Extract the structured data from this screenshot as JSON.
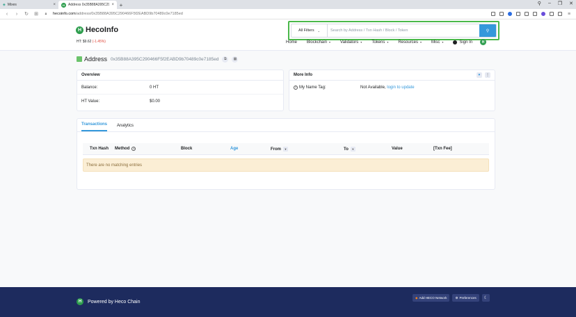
{
  "browser": {
    "tabs": [
      {
        "title": "Mixes",
        "favicon": "mixes-icon"
      },
      {
        "title": "Address 0x35B88A395C29...",
        "favicon": "heco-icon"
      }
    ],
    "url_host": "hecoinfo.com",
    "url_path": "/address/0x35B88A395C290466F5f2EABD9b70489c0e7185ed"
  },
  "header": {
    "logo_text": "HecoInfo",
    "price_label": "HT: $9.62",
    "price_change": "(-1.45%)",
    "search": {
      "filter_label": "All Filters",
      "placeholder": "Search by Address / Txn Hash / Block / Token"
    },
    "nav": [
      "Home",
      "Blockchain",
      "Validators",
      "Tokens",
      "Resources",
      "Misc",
      "Sign In"
    ]
  },
  "page": {
    "title": "Address",
    "address": "0x35B88A395C290466F5f2EABD9b70489c0e7185ed"
  },
  "overview": {
    "heading": "Overview",
    "rows": [
      {
        "label": "Balance:",
        "value": "0 HT"
      },
      {
        "label": "HT Value:",
        "value": "$0.00"
      }
    ]
  },
  "more_info": {
    "heading": "More Info",
    "name_tag_label": "My Name Tag:",
    "name_tag_value": "Not Available,",
    "name_tag_link": "login to update"
  },
  "txn": {
    "tabs": [
      "Transactions",
      "Analytics"
    ],
    "columns": [
      "Txn Hash",
      "Method",
      "Block",
      "Age",
      "From",
      "To",
      "Value",
      "[Txn Fee]"
    ],
    "empty_text": "There are no matching entries"
  },
  "footer": {
    "powered_text": "Powered by Heco Chain",
    "add_network": "Add HECO Network",
    "preferences": "Preferences"
  },
  "colors": {
    "accent": "#3498db",
    "brand_green": "#2f9e4f",
    "footer_bg": "#1d2b5e",
    "negative": "#de4437"
  }
}
